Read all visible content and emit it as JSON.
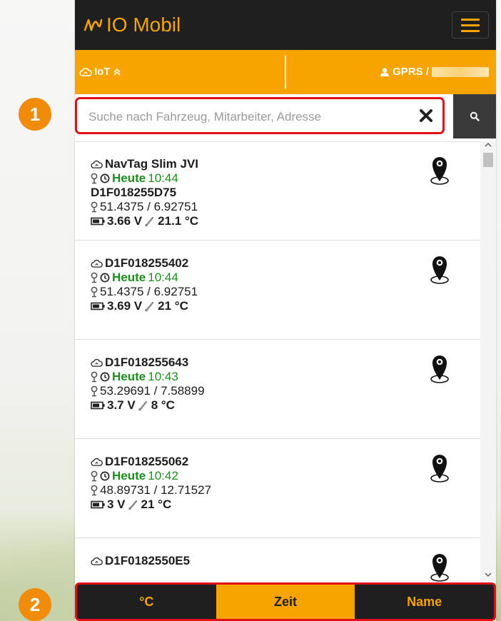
{
  "app": {
    "title": "IO Mobil",
    "colors": {
      "accent": "#f7a400",
      "dark": "#1f1f1f",
      "highlight": "#e0101a",
      "green": "#1a8f1a",
      "badge": "#f08c0a"
    }
  },
  "status": {
    "left_label": "IoT",
    "right_label": "GPRS /"
  },
  "search": {
    "placeholder": "Suche nach Fahrzeug, Mitarbeiter, Adresse",
    "value": ""
  },
  "items": [
    {
      "name": "NavTag Slim JVI",
      "day": "Heute",
      "time": "10:44",
      "id": "D1F018255D75",
      "coords": "51.4375 / 6.92751",
      "voltage": "3.66 V",
      "temp": "21.1 °C"
    },
    {
      "name": "D1F018255402",
      "day": "Heute",
      "time": "10:44",
      "coords": "51.4375 / 6.92751",
      "voltage": "3.69 V",
      "temp": "21 °C"
    },
    {
      "name": "D1F018255643",
      "day": "Heute",
      "time": "10:43",
      "coords": "53.29691 / 7.58899",
      "voltage": "3.7 V",
      "temp": "8 °C"
    },
    {
      "name": "D1F018255062",
      "day": "Heute",
      "time": "10:42",
      "coords": "48.89731 / 12.71527",
      "voltage": "3 V",
      "temp": "21 °C"
    },
    {
      "name": "D1F0182550E5"
    }
  ],
  "sort": {
    "temp_label": "°C",
    "time_label": "Zeit",
    "name_label": "Name",
    "active": "Zeit"
  },
  "badges": {
    "one": "1",
    "two": "2"
  },
  "icons": {
    "brand": "io-logo-icon",
    "menu": "hamburger-icon",
    "cloud": "cloud-sync-icon",
    "chevrons": "double-chevron-up-icon",
    "user": "user-icon",
    "clear": "close-icon",
    "search": "search-icon",
    "pin": "pin-icon",
    "clock": "clock-icon",
    "battery": "battery-icon",
    "thermo": "thermometer-icon",
    "marker": "map-marker-icon"
  }
}
